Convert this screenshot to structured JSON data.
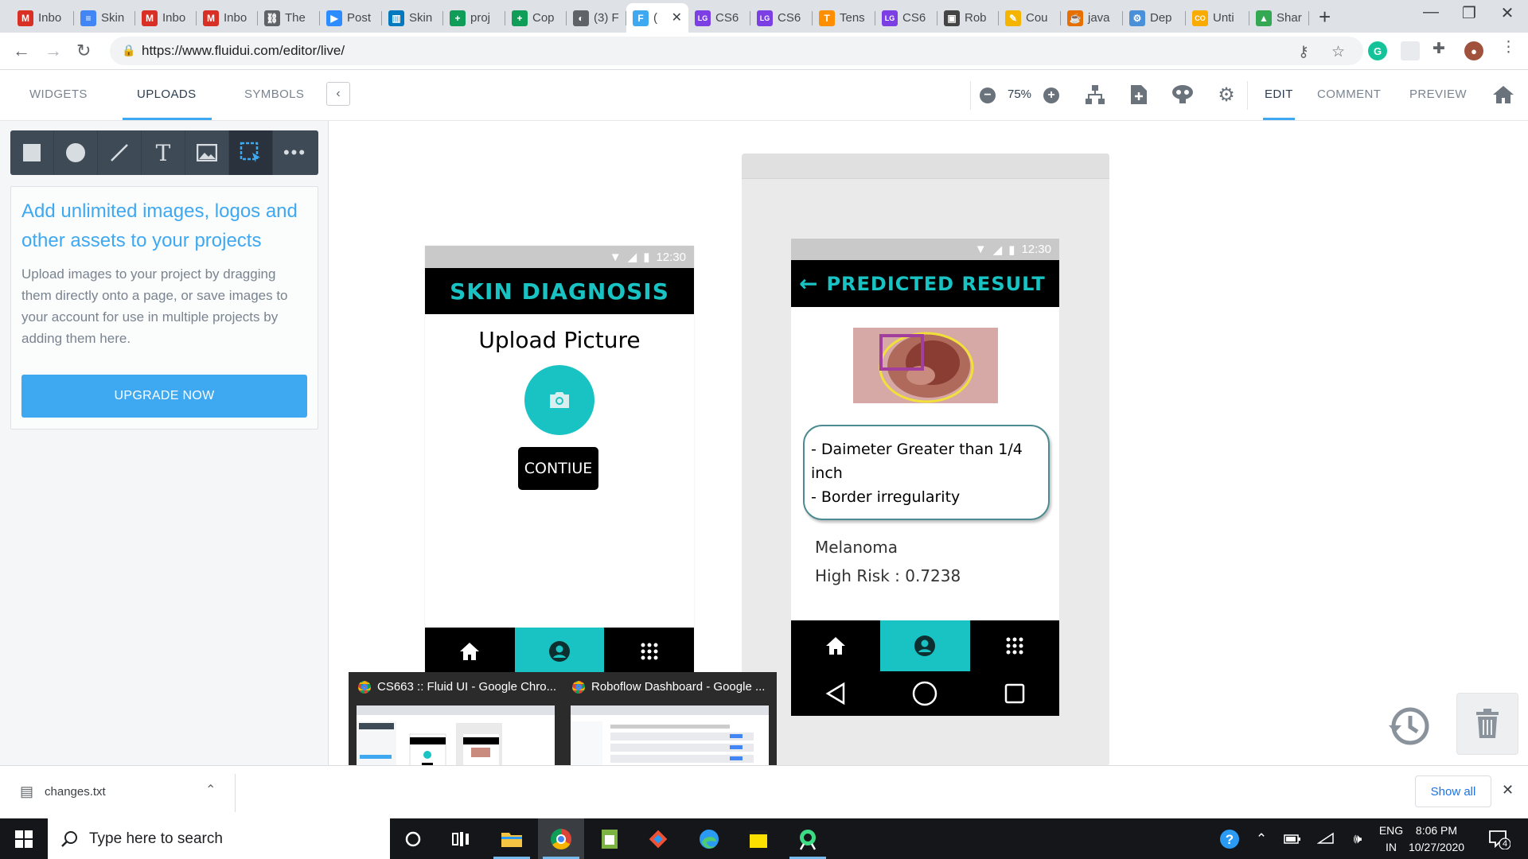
{
  "browser": {
    "tabs": [
      {
        "label": "Inbo",
        "icon": "gmail-icon",
        "color": "#d93025",
        "glyph": "M"
      },
      {
        "label": "Skin",
        "icon": "docs-icon",
        "color": "#4285f4",
        "glyph": "≡"
      },
      {
        "label": "Inbo",
        "icon": "gmail-icon",
        "color": "#d93025",
        "glyph": "M"
      },
      {
        "label": "Inbo",
        "icon": "gmail-icon",
        "color": "#d93025",
        "glyph": "M"
      },
      {
        "label": "The",
        "icon": "link-icon",
        "color": "#5f6368",
        "glyph": "⛓"
      },
      {
        "label": "Post",
        "icon": "zoom-icon",
        "color": "#2d8cff",
        "glyph": "▶"
      },
      {
        "label": "Skin",
        "icon": "trello-icon",
        "color": "#0079bf",
        "glyph": "▥"
      },
      {
        "label": "proj",
        "icon": "sheets-icon",
        "color": "#0f9d58",
        "glyph": "+"
      },
      {
        "label": "Cop",
        "icon": "sheets-icon",
        "color": "#0f9d58",
        "glyph": "+"
      },
      {
        "label": "(3) F",
        "icon": "loading-icon",
        "color": "#5f6368",
        "glyph": "◐"
      },
      {
        "label": "(",
        "icon": "fluidui-icon",
        "color": "#3ea8f0",
        "glyph": "F"
      },
      {
        "label": "CS6",
        "icon": "lg-icon",
        "color": "#7b3fe4",
        "glyph": "LG"
      },
      {
        "label": "CS6",
        "icon": "lg-icon",
        "color": "#7b3fe4",
        "glyph": "LG"
      },
      {
        "label": "Tens",
        "icon": "tensorflow-icon",
        "color": "#ff8f00",
        "glyph": "T"
      },
      {
        "label": "CS6",
        "icon": "lg-icon",
        "color": "#7b3fe4",
        "glyph": "LG"
      },
      {
        "label": "Rob",
        "icon": "roboflow-icon",
        "color": "#444444",
        "glyph": "▣"
      },
      {
        "label": "Cou",
        "icon": "course-icon",
        "color": "#f4b400",
        "glyph": "✎"
      },
      {
        "label": "java",
        "icon": "java-icon",
        "color": "#e76f00",
        "glyph": "☕"
      },
      {
        "label": "Dep",
        "icon": "deploy-icon",
        "color": "#4a90d9",
        "glyph": "⚙"
      },
      {
        "label": "Unti",
        "icon": "colab-icon",
        "color": "#f9ab00",
        "glyph": "CO"
      },
      {
        "label": "Shar",
        "icon": "drive-icon",
        "color": "#34a853",
        "glyph": "▲"
      }
    ],
    "url": "https://www.fluidui.com/editor/live/"
  },
  "app_header": {
    "tabs": [
      "WIDGETS",
      "UPLOADS",
      "SYMBOLS"
    ],
    "active_tab": "UPLOADS",
    "zoom": "75%",
    "modes": [
      "EDIT",
      "COMMENT",
      "PREVIEW"
    ],
    "active_mode": "EDIT"
  },
  "sidebar": {
    "heading": "Add unlimited images, logos and other assets to your projects",
    "body": "Upload images to your project by dragging them directly onto a page, or save images to your account for use in multiple projects by adding them here.",
    "upgrade_label": "UPGRADE NOW"
  },
  "screen1": {
    "time": "12:30",
    "title": "SKIN DIAGNOSIS",
    "upload_label": "Upload Picture",
    "continue_label": "CONTIUE"
  },
  "screen2": {
    "time": "12:30",
    "title": "PREDICTED RESULT",
    "findings": [
      "- Daimeter Greater than 1/4 inch",
      "- Border irregularity"
    ],
    "diagnosis": "Melanoma",
    "risk": "High Risk : 0.7238"
  },
  "thumbnails": [
    {
      "title": "CS663 :: Fluid UI - Google Chro..."
    },
    {
      "title": "Roboflow Dashboard - Google ..."
    }
  ],
  "downloads": {
    "file": "changes.txt",
    "show_all": "Show all"
  },
  "taskbar": {
    "search_placeholder": "Type here to search",
    "lang_line1": "ENG",
    "lang_line2": "IN",
    "time": "8:06 PM",
    "date": "10/27/2020",
    "notification_count": "4"
  },
  "colors": {
    "accent": "#3ea8f0",
    "teal": "#19c3c3"
  }
}
